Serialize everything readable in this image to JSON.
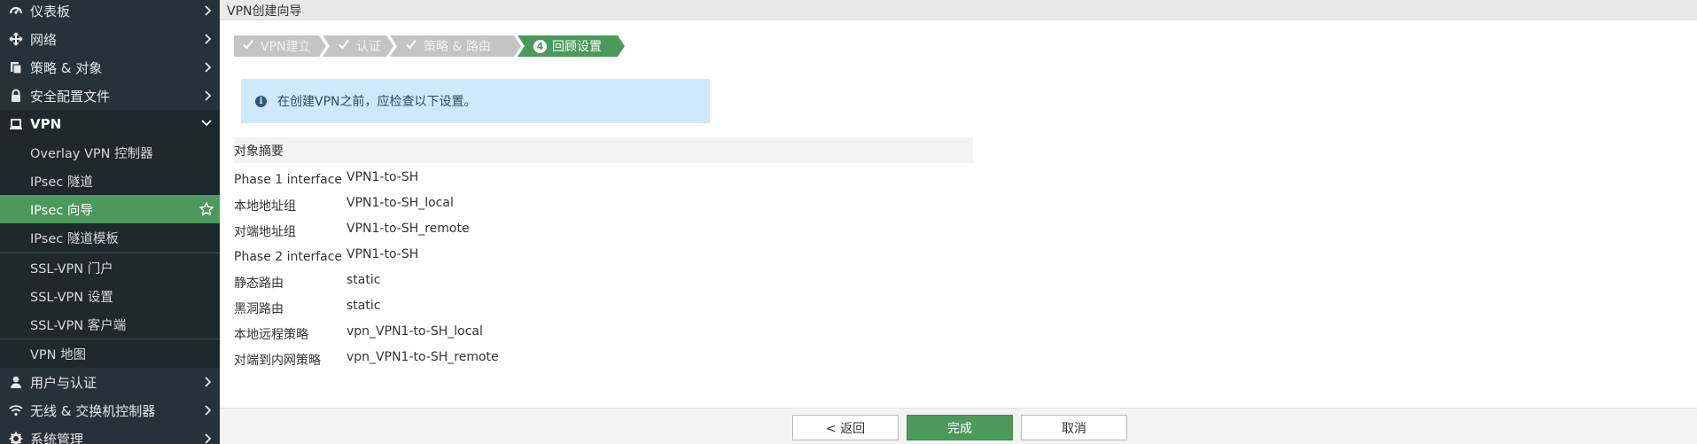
{
  "sidebar": {
    "items": [
      {
        "label": "仪表板",
        "icon": "dashboard-icon"
      },
      {
        "label": "网络",
        "icon": "network-icon"
      },
      {
        "label": "策略 & 对象",
        "icon": "policy-icon"
      },
      {
        "label": "安全配置文件",
        "icon": "lock-icon"
      },
      {
        "label": "VPN",
        "icon": "laptop-icon"
      },
      {
        "label": "用户与认证",
        "icon": "user-icon"
      },
      {
        "label": "无线 & 交换机控制器",
        "icon": "wifi-icon"
      },
      {
        "label": "系统管理",
        "icon": "gear-icon"
      }
    ],
    "vpn_subitems": [
      {
        "label": "Overlay VPN 控制器"
      },
      {
        "label": "IPsec 隧道"
      },
      {
        "label": "IPsec 向导"
      },
      {
        "label": "IPsec 隧道模板"
      },
      {
        "label": "SSL-VPN 门户"
      },
      {
        "label": "SSL-VPN 设置"
      },
      {
        "label": "SSL-VPN 客户端"
      },
      {
        "label": "VPN 地图"
      }
    ],
    "active_color": "#4b9a5b",
    "bg_color": "#263238"
  },
  "page": {
    "title": "VPN创建向导"
  },
  "wizard": {
    "steps": [
      {
        "label": "VPN建立",
        "state": "done"
      },
      {
        "label": "认证",
        "state": "done"
      },
      {
        "label": "策略 & 路由",
        "state": "done"
      },
      {
        "label": "回顾设置",
        "state": "current",
        "number": "4"
      }
    ]
  },
  "info": {
    "text": "在创建VPN之前，应检查以下设置。"
  },
  "summary": {
    "heading": "对象摘要",
    "rows": [
      {
        "key": "Phase 1 interface",
        "value": "VPN1-to-SH"
      },
      {
        "key": "本地地址组",
        "value": "VPN1-to-SH_local"
      },
      {
        "key": "对端地址组",
        "value": "VPN1-to-SH_remote"
      },
      {
        "key": "Phase 2 interface",
        "value": "VPN1-to-SH"
      },
      {
        "key": "静态路由",
        "value": "static"
      },
      {
        "key": "黑洞路由",
        "value": "static"
      },
      {
        "key": "本地远程策略",
        "value": "vpn_VPN1-to-SH_local"
      },
      {
        "key": "对端到内网策略",
        "value": "vpn_VPN1-to-SH_remote"
      }
    ]
  },
  "footer": {
    "back_label": "< 返回",
    "finish_label": "完成",
    "cancel_label": "取消"
  }
}
